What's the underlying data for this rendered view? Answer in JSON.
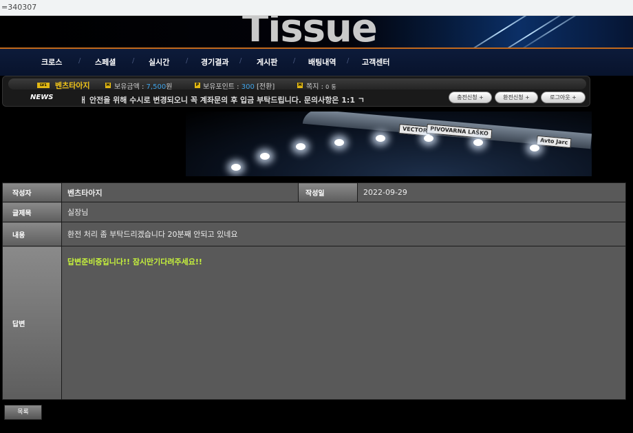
{
  "url": "=340307",
  "site": {
    "logo": "Tissue"
  },
  "nav": [
    "크로스",
    "스페셜",
    "실시간",
    "경기결과",
    "게시판",
    "배팅내역",
    "고객센터"
  ],
  "user": {
    "level_badge": "LV1",
    "name": "벤츠타아지",
    "balance_label": "보유금액 :",
    "balance": "7,500",
    "balance_unit": "원",
    "points_label": "보유포인트 :",
    "points": "300",
    "points_convert": "[전환]",
    "memo_label": "쪽지 :",
    "memo_count": "0",
    "memo_unit": "통"
  },
  "news": {
    "label": "NEWS",
    "ticker": "ㅐ 안전을 위해 수시로 변경되오니 꼭 계좌문의 후 입금 부탁드립니다. 문의사항은 1:1 ㄱ"
  },
  "buttons": {
    "deposit": "충전신청",
    "withdraw": "환전신청",
    "logout": "로그아웃"
  },
  "stadium_signs": [
    "VECTOR",
    "PIVOVARNA LAŠKO",
    "Avto Jarc"
  ],
  "post": {
    "author_label": "작성자",
    "author": "벤츠타아지",
    "date_label": "작성일",
    "date": "2022-09-29",
    "title_label": "글제목",
    "title": "실장님",
    "content_label": "내용",
    "content": "환전 처리 좀 부탁드리겠습니다 20분째 안되고 있네요",
    "answer_label": "답변",
    "answer": "답변준비중입니다!! 잠시만기다려주세요!!"
  },
  "list_button": "목록",
  "colors": {
    "accent_gold": "#f0c419",
    "value_blue": "#3fa3e8",
    "answer_green": "#c6f23c",
    "nav_orange": "#c46a1c"
  }
}
